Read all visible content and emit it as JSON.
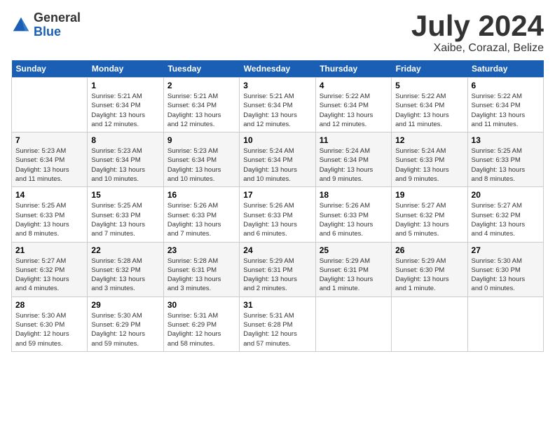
{
  "logo": {
    "general": "General",
    "blue": "Blue"
  },
  "title": {
    "month": "July 2024",
    "location": "Xaibe, Corazal, Belize"
  },
  "columns": [
    "Sunday",
    "Monday",
    "Tuesday",
    "Wednesday",
    "Thursday",
    "Friday",
    "Saturday"
  ],
  "weeks": [
    [
      {
        "day": "",
        "info": ""
      },
      {
        "day": "1",
        "info": "Sunrise: 5:21 AM\nSunset: 6:34 PM\nDaylight: 13 hours\nand 12 minutes."
      },
      {
        "day": "2",
        "info": "Sunrise: 5:21 AM\nSunset: 6:34 PM\nDaylight: 13 hours\nand 12 minutes."
      },
      {
        "day": "3",
        "info": "Sunrise: 5:21 AM\nSunset: 6:34 PM\nDaylight: 13 hours\nand 12 minutes."
      },
      {
        "day": "4",
        "info": "Sunrise: 5:22 AM\nSunset: 6:34 PM\nDaylight: 13 hours\nand 12 minutes."
      },
      {
        "day": "5",
        "info": "Sunrise: 5:22 AM\nSunset: 6:34 PM\nDaylight: 13 hours\nand 11 minutes."
      },
      {
        "day": "6",
        "info": "Sunrise: 5:22 AM\nSunset: 6:34 PM\nDaylight: 13 hours\nand 11 minutes."
      }
    ],
    [
      {
        "day": "7",
        "info": "Sunrise: 5:23 AM\nSunset: 6:34 PM\nDaylight: 13 hours\nand 11 minutes."
      },
      {
        "day": "8",
        "info": "Sunrise: 5:23 AM\nSunset: 6:34 PM\nDaylight: 13 hours\nand 10 minutes."
      },
      {
        "day": "9",
        "info": "Sunrise: 5:23 AM\nSunset: 6:34 PM\nDaylight: 13 hours\nand 10 minutes."
      },
      {
        "day": "10",
        "info": "Sunrise: 5:24 AM\nSunset: 6:34 PM\nDaylight: 13 hours\nand 10 minutes."
      },
      {
        "day": "11",
        "info": "Sunrise: 5:24 AM\nSunset: 6:34 PM\nDaylight: 13 hours\nand 9 minutes."
      },
      {
        "day": "12",
        "info": "Sunrise: 5:24 AM\nSunset: 6:33 PM\nDaylight: 13 hours\nand 9 minutes."
      },
      {
        "day": "13",
        "info": "Sunrise: 5:25 AM\nSunset: 6:33 PM\nDaylight: 13 hours\nand 8 minutes."
      }
    ],
    [
      {
        "day": "14",
        "info": "Sunrise: 5:25 AM\nSunset: 6:33 PM\nDaylight: 13 hours\nand 8 minutes."
      },
      {
        "day": "15",
        "info": "Sunrise: 5:25 AM\nSunset: 6:33 PM\nDaylight: 13 hours\nand 7 minutes."
      },
      {
        "day": "16",
        "info": "Sunrise: 5:26 AM\nSunset: 6:33 PM\nDaylight: 13 hours\nand 7 minutes."
      },
      {
        "day": "17",
        "info": "Sunrise: 5:26 AM\nSunset: 6:33 PM\nDaylight: 13 hours\nand 6 minutes."
      },
      {
        "day": "18",
        "info": "Sunrise: 5:26 AM\nSunset: 6:33 PM\nDaylight: 13 hours\nand 6 minutes."
      },
      {
        "day": "19",
        "info": "Sunrise: 5:27 AM\nSunset: 6:32 PM\nDaylight: 13 hours\nand 5 minutes."
      },
      {
        "day": "20",
        "info": "Sunrise: 5:27 AM\nSunset: 6:32 PM\nDaylight: 13 hours\nand 4 minutes."
      }
    ],
    [
      {
        "day": "21",
        "info": "Sunrise: 5:27 AM\nSunset: 6:32 PM\nDaylight: 13 hours\nand 4 minutes."
      },
      {
        "day": "22",
        "info": "Sunrise: 5:28 AM\nSunset: 6:32 PM\nDaylight: 13 hours\nand 3 minutes."
      },
      {
        "day": "23",
        "info": "Sunrise: 5:28 AM\nSunset: 6:31 PM\nDaylight: 13 hours\nand 3 minutes."
      },
      {
        "day": "24",
        "info": "Sunrise: 5:29 AM\nSunset: 6:31 PM\nDaylight: 13 hours\nand 2 minutes."
      },
      {
        "day": "25",
        "info": "Sunrise: 5:29 AM\nSunset: 6:31 PM\nDaylight: 13 hours\nand 1 minute."
      },
      {
        "day": "26",
        "info": "Sunrise: 5:29 AM\nSunset: 6:30 PM\nDaylight: 13 hours\nand 1 minute."
      },
      {
        "day": "27",
        "info": "Sunrise: 5:30 AM\nSunset: 6:30 PM\nDaylight: 13 hours\nand 0 minutes."
      }
    ],
    [
      {
        "day": "28",
        "info": "Sunrise: 5:30 AM\nSunset: 6:30 PM\nDaylight: 12 hours\nand 59 minutes."
      },
      {
        "day": "29",
        "info": "Sunrise: 5:30 AM\nSunset: 6:29 PM\nDaylight: 12 hours\nand 59 minutes."
      },
      {
        "day": "30",
        "info": "Sunrise: 5:31 AM\nSunset: 6:29 PM\nDaylight: 12 hours\nand 58 minutes."
      },
      {
        "day": "31",
        "info": "Sunrise: 5:31 AM\nSunset: 6:28 PM\nDaylight: 12 hours\nand 57 minutes."
      },
      {
        "day": "",
        "info": ""
      },
      {
        "day": "",
        "info": ""
      },
      {
        "day": "",
        "info": ""
      }
    ]
  ]
}
